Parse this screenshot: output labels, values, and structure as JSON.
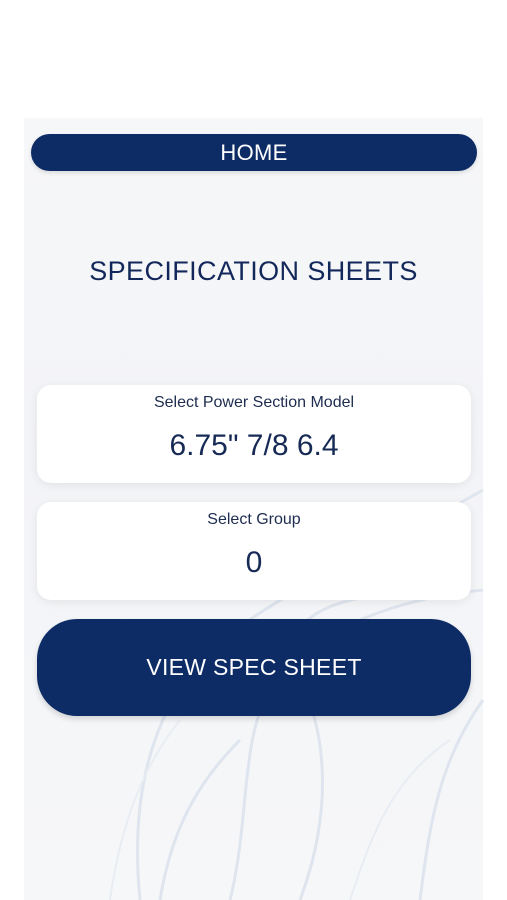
{
  "header": {
    "home_label": "HOME"
  },
  "main": {
    "title": "SPECIFICATION SHEETS",
    "model_selector": {
      "label": "Select Power Section Model",
      "value": "6.75\" 7/8 6.4"
    },
    "group_selector": {
      "label": "Select Group",
      "value": "0"
    },
    "view_button_label": "VIEW SPEC SHEET"
  },
  "colors": {
    "primary": "#0d2c66",
    "text_dark": "#13285a",
    "panel_bg": "#f4f5f8",
    "card_bg": "#ffffff"
  }
}
